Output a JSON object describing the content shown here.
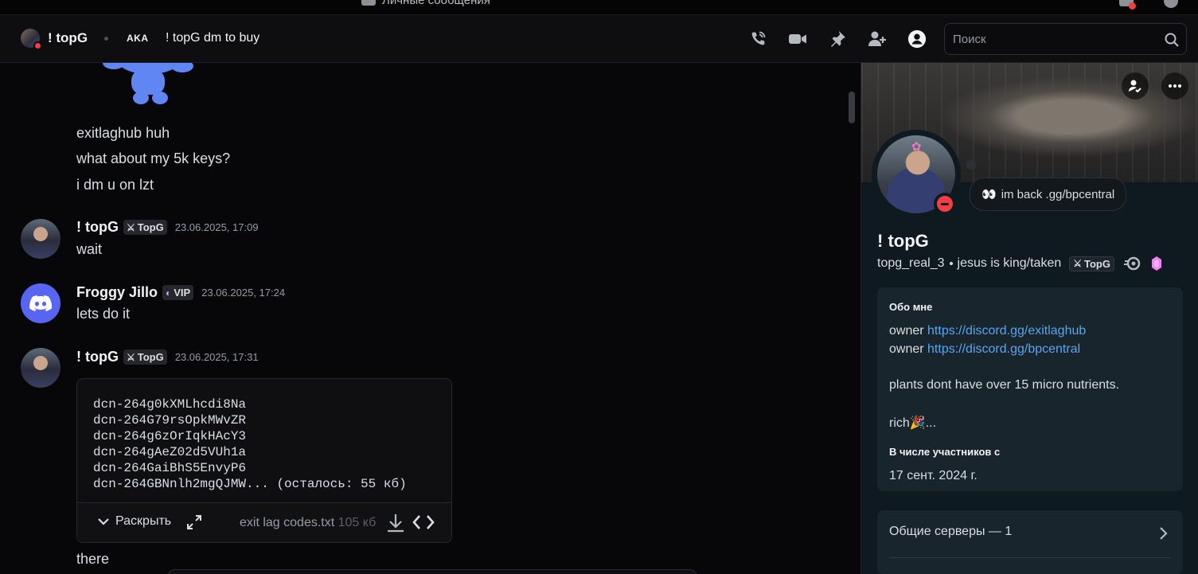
{
  "titlebar": {
    "title": "Личные сообщения"
  },
  "header": {
    "name": "! topG",
    "aka_label": "AKA",
    "aka_value": "! topG dm to buy",
    "search_placeholder": "Поиск"
  },
  "chat": {
    "early_messages": [
      "exitlaghub huh",
      "what about my 5k keys?",
      "i dm u on lzt"
    ],
    "messages": [
      {
        "author": "! topG",
        "tag": "TopG",
        "time": "23.06.2025, 17:09",
        "text": "wait"
      },
      {
        "author": "Froggy Jillo",
        "tag": "VIP",
        "time": "23.06.2025, 17:24",
        "text": "lets do it"
      },
      {
        "author": "! topG",
        "tag": "TopG",
        "time": "23.06.2025, 17:31"
      }
    ],
    "file": {
      "lines": [
        "dcn-264g0kXMLhcdi8Na",
        "dcn-264G79rsOpkMWvZR",
        "dcn-264g6zOrIqkHAcY3",
        "dcn-264gAeZ02d5VUh1a",
        "dcn-264GaiBhS5EnvyP6",
        "dcn-264GBNnlh2mgQJMW... (осталось: 55 кб)"
      ],
      "expand_label": "Раскрыть",
      "filename": "exit lag codes.txt",
      "size": "105 кб"
    },
    "last_message": "there"
  },
  "profile": {
    "status": "im back .gg/bpcentral",
    "name": "! topG",
    "username": "topg_real_3",
    "pronouns": "jesus is king/taken",
    "tag": "TopG",
    "about_heading": "Обо мне",
    "about_prefix_1": "owner ",
    "about_link_1": "https://discord.gg/exitlaghub",
    "about_prefix_2": "owner ",
    "about_link_2": "https://discord.gg/bpcentral",
    "about_line_3": "plants dont have over 15 micro nutrients.",
    "about_line_4": "rich",
    "about_line_4_suffix": "...",
    "member_since_heading": "В числе участников с",
    "member_since": "17 сент. 2024 г.",
    "mutual_servers": "Общие серверы — 1"
  },
  "colors": {
    "accent_link": "#5aa4f0",
    "dnd_red": "#f23f43",
    "discord_blurple": "#5865f2",
    "nitro_pink": "#f47fff"
  },
  "icons": [
    "phone-icon",
    "video-icon",
    "pin-icon",
    "add-friend-icon",
    "profile-toggle-icon",
    "search-icon",
    "download-icon",
    "code-icon",
    "chevron-right-icon"
  ]
}
